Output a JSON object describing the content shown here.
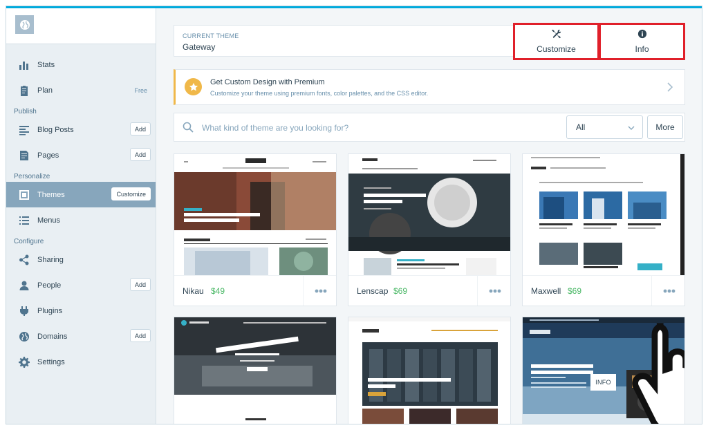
{
  "sidebar": {
    "plan_tag": "Free",
    "items": {
      "stats": "Stats",
      "plan": "Plan",
      "blog_posts": "Blog Posts",
      "pages": "Pages",
      "themes": "Themes",
      "menus": "Menus",
      "sharing": "Sharing",
      "people": "People",
      "plugins": "Plugins",
      "domains": "Domains",
      "settings": "Settings"
    },
    "sections": {
      "publish": "Publish",
      "personalize": "Personalize",
      "configure": "Configure"
    },
    "buttons": {
      "add": "Add",
      "customize": "Customize"
    }
  },
  "current_theme": {
    "label": "CURRENT THEME",
    "name": "Gateway",
    "customize_label": "Customize",
    "info_label": "Info",
    "highlight_color": "#e0202a"
  },
  "premium_banner": {
    "title": "Get Custom Design with Premium",
    "description": "Customize your theme using premium fonts, color palettes, and the CSS editor.",
    "accent_color": "#f0b849"
  },
  "search": {
    "placeholder": "What kind of theme are you looking for?",
    "filter_value": "All",
    "more_label": "More"
  },
  "themes": [
    {
      "name": "Nikau",
      "price": "$49"
    },
    {
      "name": "Lenscap",
      "price": "$69"
    },
    {
      "name": "Maxwell",
      "price": "$69"
    },
    {
      "name": "",
      "price": ""
    },
    {
      "name": "",
      "price": ""
    },
    {
      "name": "",
      "price": ""
    }
  ],
  "hover_info_label": "INFO",
  "colors": {
    "accent_blue": "#00aadc",
    "price_green": "#4ab866",
    "sidebar_active": "#87a6bc"
  }
}
